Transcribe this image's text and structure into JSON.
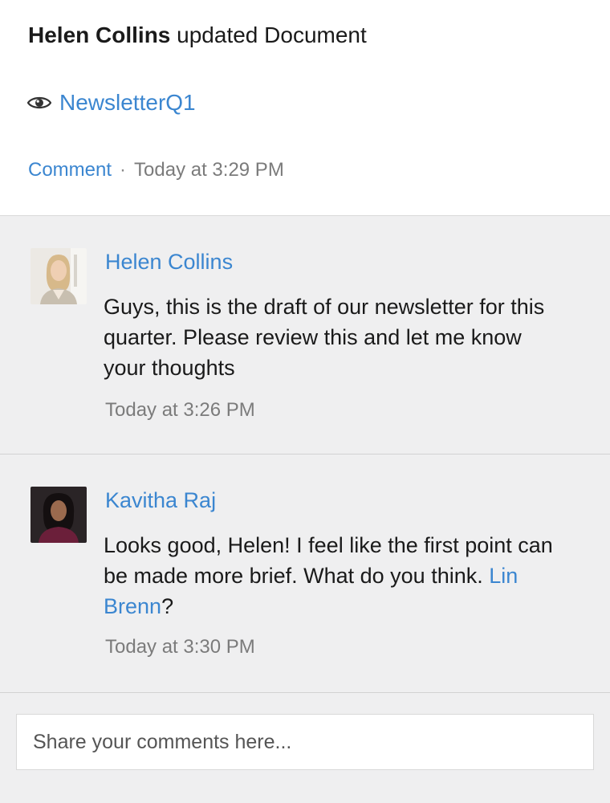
{
  "activity": {
    "actor": "Helen Collins",
    "action": "updated Document",
    "document_name": "NewsletterQ1",
    "comment_label": "Comment",
    "separator": "·",
    "timestamp": "Today at 3:29 PM"
  },
  "comments": [
    {
      "author": "Helen Collins",
      "text": "Guys, this is the draft of our newsletter for this quarter. Please review this and let me know your thoughts",
      "time": "Today at 3:26 PM"
    },
    {
      "author": "Kavitha Raj",
      "text_before": "Looks good, Helen! I feel like the first point can be made more brief. What do you think. ",
      "mention": "Lin Brenn",
      "text_after": "?",
      "time": "Today at 3:30 PM"
    }
  ],
  "comment_input": {
    "placeholder": "Share your comments here...",
    "value": ""
  },
  "colors": {
    "link": "#3b86d0",
    "background": "#efeff0",
    "header_background": "#ffffff"
  }
}
